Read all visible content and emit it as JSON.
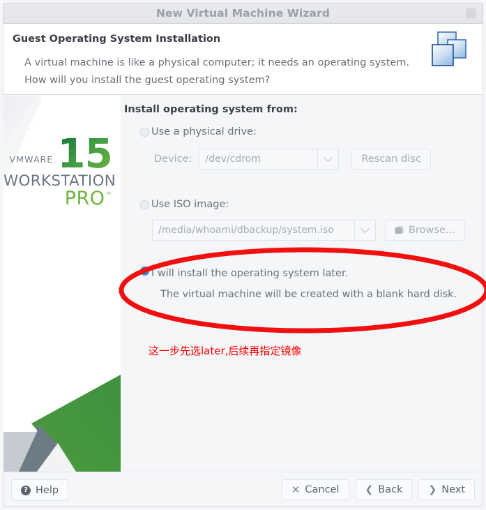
{
  "window": {
    "title": "New Virtual Machine Wizard",
    "close_icon": "close-icon"
  },
  "header": {
    "title": "Guest Operating System Installation",
    "description": "A virtual machine is like a physical computer; it needs an operating system. How will you install the guest operating system?",
    "icon": "stacked-windows-icon"
  },
  "sidebar": {
    "brand": "VMWARE",
    "version": "15",
    "product": "WORKSTATION",
    "edition": "PRO",
    "trademark": "™"
  },
  "main": {
    "section_label": "Install operating system from:",
    "options": [
      {
        "id": "physical-drive",
        "label": "Use a physical drive:",
        "selected": false,
        "field_label": "Device:",
        "combo_value": "/dev/cdrom",
        "button_label": "Rescan disc",
        "button_icon": ""
      },
      {
        "id": "iso-image",
        "label": "Use ISO image:",
        "selected": false,
        "field_label": "",
        "combo_value": "/media/whoami/dbackup/system.iso",
        "button_label": "Browse...",
        "button_icon": "folder-stack-icon"
      },
      {
        "id": "install-later",
        "label": "I will install the operating system later.",
        "sublabel": "The virtual machine will be created with a blank hard disk.",
        "selected": true
      }
    ],
    "annotation_note": "这一步先选later,后续再指定镜像",
    "annotation_color": "#ff0000"
  },
  "footer": {
    "help_label": "Help",
    "help_icon": "question-mark-icon",
    "cancel_label": "Cancel",
    "cancel_icon": "x-icon",
    "back_label": "Back",
    "back_icon": "chevron-left-icon",
    "next_label": "Next",
    "next_icon": "chevron-right-icon"
  },
  "colors": {
    "accent_blue": "#2f8ae0",
    "brand_green": "#6cb33f",
    "annotation_red": "#ff0000",
    "window_bg": "#f5f6f8",
    "text_muted": "#6a6f78"
  }
}
